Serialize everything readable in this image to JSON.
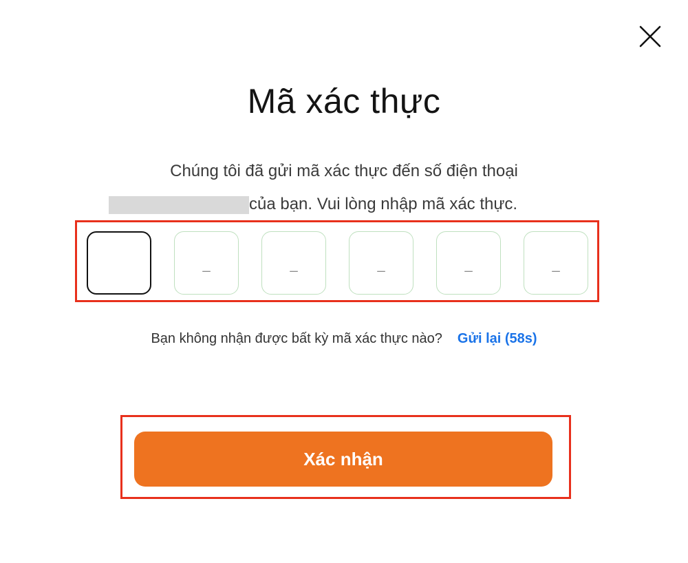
{
  "dialog": {
    "title": "Mã xác thực",
    "message_line1": "Chúng tôi đã gửi mã xác thực đến số điện thoại",
    "message_line2": "của bạn. Vui lòng nhập mã xác thực.",
    "close_icon": "close-icon"
  },
  "otp": {
    "digits": [
      "",
      "_",
      "_",
      "_",
      "_",
      "_"
    ],
    "active_index": 0
  },
  "resend": {
    "question": "Bạn không nhận được bất kỳ mã xác thực nào?",
    "link_label": "Gửi lại (58s)"
  },
  "actions": {
    "confirm_label": "Xác nhận"
  },
  "colors": {
    "accent": "#ee7320",
    "link": "#1a73e8",
    "highlight": "#e8301c",
    "otp_border": "#bfe0bf"
  }
}
